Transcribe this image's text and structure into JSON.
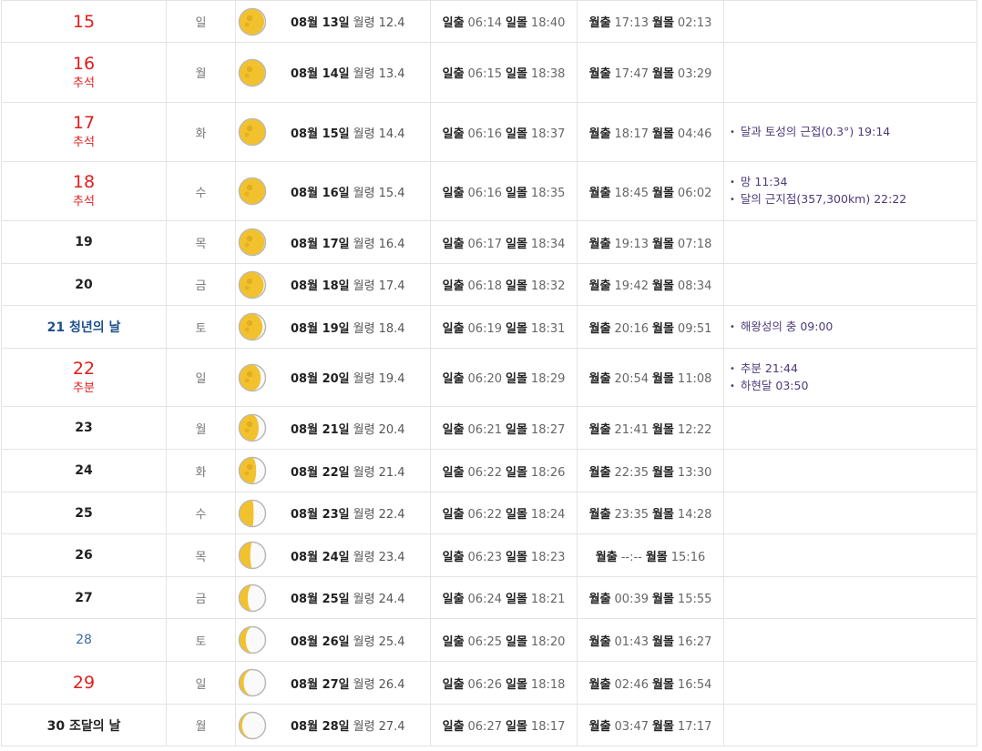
{
  "rows": [
    {
      "day": "15",
      "holiday": "",
      "style": "red-single",
      "dow": "일",
      "month_day": "08월 13일",
      "age_label": "월령",
      "age": "12.4",
      "sunrise_label": "일출",
      "sunrise": "06:14",
      "sunset_label": "일몰",
      "sunset": "18:40",
      "moonrise_label": "월출",
      "moonrise": "17:13",
      "moonset_label": "월몰",
      "moonset": "02:13",
      "events": []
    },
    {
      "day": "16",
      "holiday": "추석",
      "style": "red",
      "dow": "월",
      "month_day": "08월 14일",
      "age_label": "월령",
      "age": "13.4",
      "sunrise_label": "일출",
      "sunrise": "06:15",
      "sunset_label": "일몰",
      "sunset": "18:38",
      "moonrise_label": "월출",
      "moonrise": "17:47",
      "moonset_label": "월몰",
      "moonset": "03:29",
      "events": []
    },
    {
      "day": "17",
      "holiday": "추석",
      "style": "red",
      "dow": "화",
      "month_day": "08월 15일",
      "age_label": "월령",
      "age": "14.4",
      "sunrise_label": "일출",
      "sunrise": "06:16",
      "sunset_label": "일몰",
      "sunset": "18:37",
      "moonrise_label": "월출",
      "moonrise": "18:17",
      "moonset_label": "월몰",
      "moonset": "04:46",
      "events": [
        "달과 토성의 근접(0.3°) 19:14"
      ]
    },
    {
      "day": "18",
      "holiday": "추석",
      "style": "red",
      "dow": "수",
      "month_day": "08월 16일",
      "age_label": "월령",
      "age": "15.4",
      "sunrise_label": "일출",
      "sunrise": "06:16",
      "sunset_label": "일몰",
      "sunset": "18:35",
      "moonrise_label": "월출",
      "moonrise": "18:45",
      "moonset_label": "월몰",
      "moonset": "06:02",
      "events": [
        "망 11:34",
        "달의 근지점(357,300km) 22:22"
      ]
    },
    {
      "day": "19",
      "holiday": "",
      "style": "plain",
      "dow": "목",
      "month_day": "08월 17일",
      "age_label": "월령",
      "age": "16.4",
      "sunrise_label": "일출",
      "sunrise": "06:17",
      "sunset_label": "일몰",
      "sunset": "18:34",
      "moonrise_label": "월출",
      "moonrise": "19:13",
      "moonset_label": "월몰",
      "moonset": "07:18",
      "events": []
    },
    {
      "day": "20",
      "holiday": "",
      "style": "plain",
      "dow": "금",
      "month_day": "08월 18일",
      "age_label": "월령",
      "age": "17.4",
      "sunrise_label": "일출",
      "sunrise": "06:18",
      "sunset_label": "일몰",
      "sunset": "18:32",
      "moonrise_label": "월출",
      "moonrise": "19:42",
      "moonset_label": "월몰",
      "moonset": "08:34",
      "events": []
    },
    {
      "day": "21 청년의 날",
      "holiday": "",
      "style": "blue",
      "dow": "토",
      "month_day": "08월 19일",
      "age_label": "월령",
      "age": "18.4",
      "sunrise_label": "일출",
      "sunrise": "06:19",
      "sunset_label": "일몰",
      "sunset": "18:31",
      "moonrise_label": "월출",
      "moonrise": "20:16",
      "moonset_label": "월몰",
      "moonset": "09:51",
      "events": [
        "해왕성의 충 09:00"
      ]
    },
    {
      "day": "22",
      "holiday": "추분",
      "style": "red",
      "dow": "일",
      "month_day": "08월 20일",
      "age_label": "월령",
      "age": "19.4",
      "sunrise_label": "일출",
      "sunrise": "06:20",
      "sunset_label": "일몰",
      "sunset": "18:29",
      "moonrise_label": "월출",
      "moonrise": "20:54",
      "moonset_label": "월몰",
      "moonset": "11:08",
      "events": [
        "추분 21:44",
        "하현달 03:50"
      ]
    },
    {
      "day": "23",
      "holiday": "",
      "style": "plain",
      "dow": "월",
      "month_day": "08월 21일",
      "age_label": "월령",
      "age": "20.4",
      "sunrise_label": "일출",
      "sunrise": "06:21",
      "sunset_label": "일몰",
      "sunset": "18:27",
      "moonrise_label": "월출",
      "moonrise": "21:41",
      "moonset_label": "월몰",
      "moonset": "12:22",
      "events": []
    },
    {
      "day": "24",
      "holiday": "",
      "style": "plain",
      "dow": "화",
      "month_day": "08월 22일",
      "age_label": "월령",
      "age": "21.4",
      "sunrise_label": "일출",
      "sunrise": "06:22",
      "sunset_label": "일몰",
      "sunset": "18:26",
      "moonrise_label": "월출",
      "moonrise": "22:35",
      "moonset_label": "월몰",
      "moonset": "13:30",
      "events": []
    },
    {
      "day": "25",
      "holiday": "",
      "style": "plain",
      "dow": "수",
      "month_day": "08월 23일",
      "age_label": "월령",
      "age": "22.4",
      "sunrise_label": "일출",
      "sunrise": "06:22",
      "sunset_label": "일몰",
      "sunset": "18:24",
      "moonrise_label": "월출",
      "moonrise": "23:35",
      "moonset_label": "월몰",
      "moonset": "14:28",
      "events": []
    },
    {
      "day": "26",
      "holiday": "",
      "style": "plain",
      "dow": "목",
      "month_day": "08월 24일",
      "age_label": "월령",
      "age": "23.4",
      "sunrise_label": "일출",
      "sunrise": "06:23",
      "sunset_label": "일몰",
      "sunset": "18:23",
      "moonrise_label": "월출",
      "moonrise": "--:--",
      "moonset_label": "월몰",
      "moonset": "15:16",
      "events": []
    },
    {
      "day": "27",
      "holiday": "",
      "style": "plain",
      "dow": "금",
      "month_day": "08월 25일",
      "age_label": "월령",
      "age": "24.4",
      "sunrise_label": "일출",
      "sunrise": "06:24",
      "sunset_label": "일몰",
      "sunset": "18:21",
      "moonrise_label": "월출",
      "moonrise": "00:39",
      "moonset_label": "월몰",
      "moonset": "15:55",
      "events": []
    },
    {
      "day": "28",
      "holiday": "",
      "style": "bluelite",
      "dow": "토",
      "month_day": "08월 26일",
      "age_label": "월령",
      "age": "25.4",
      "sunrise_label": "일출",
      "sunrise": "06:25",
      "sunset_label": "일몰",
      "sunset": "18:20",
      "moonrise_label": "월출",
      "moonrise": "01:43",
      "moonset_label": "월몰",
      "moonset": "16:27",
      "events": []
    },
    {
      "day": "29",
      "holiday": "",
      "style": "red-single",
      "dow": "일",
      "month_day": "08월 27일",
      "age_label": "월령",
      "age": "26.4",
      "sunrise_label": "일출",
      "sunrise": "06:26",
      "sunset_label": "일몰",
      "sunset": "18:18",
      "moonrise_label": "월출",
      "moonrise": "02:46",
      "moonset_label": "월몰",
      "moonset": "16:54",
      "events": []
    },
    {
      "day": "30 조달의 날",
      "holiday": "",
      "style": "plain",
      "dow": "월",
      "month_day": "08월 28일",
      "age_label": "월령",
      "age": "27.4",
      "sunrise_label": "일출",
      "sunrise": "06:27",
      "sunset_label": "일몰",
      "sunset": "18:17",
      "moonrise_label": "월출",
      "moonrise": "03:47",
      "moonset_label": "월몰",
      "moonset": "17:17",
      "events": []
    }
  ],
  "colors": {
    "holiday_red": "#e21d1d",
    "saturday_blue": "#1f4f8f",
    "event_purple": "#4e3a78",
    "moon_gold": "#f2c12e"
  },
  "icons": {
    "moon_phase": "moon-phase-icon"
  }
}
